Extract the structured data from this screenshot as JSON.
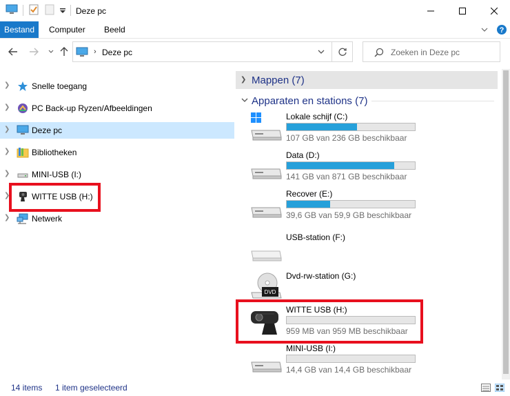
{
  "window": {
    "title": "Deze pc",
    "minimize_label": "",
    "maximize_label": "",
    "close_label": ""
  },
  "ribbon": {
    "tabs": [
      {
        "label": "Bestand",
        "active": true
      },
      {
        "label": "Computer",
        "active": false
      },
      {
        "label": "Beeld",
        "active": false
      }
    ]
  },
  "address": {
    "path": "Deze pc",
    "search_placeholder": "Zoeken in Deze pc"
  },
  "nav_pane": {
    "items": [
      {
        "label": "Snelle toegang",
        "icon": "star-icon",
        "selected": false
      },
      {
        "label": "PC Back-up Ryzen/Afbeeldingen",
        "icon": "cloud-folder-icon",
        "selected": false
      },
      {
        "label": "Deze pc",
        "icon": "computer-icon",
        "selected": true
      },
      {
        "label": "Bibliotheken",
        "icon": "library-icon",
        "selected": false
      },
      {
        "label": "MINI-USB (I:)",
        "icon": "usb-drive-icon",
        "selected": false
      },
      {
        "label": "WITTE USB (H:)",
        "icon": "webcam-icon",
        "selected": false
      },
      {
        "label": "Netwerk",
        "icon": "network-icon",
        "selected": false
      }
    ]
  },
  "content": {
    "groups": [
      {
        "label": "Mappen (7)",
        "expanded": false
      },
      {
        "label": "Apparaten en stations (7)",
        "expanded": true
      }
    ],
    "drives": [
      {
        "name": "Lokale schijf (C:)",
        "free": "107 GB van 236 GB beschikbaar",
        "used_fraction": 0.547,
        "icon": "windows-drive-icon",
        "has_bar": true
      },
      {
        "name": "Data (D:)",
        "free": "141 GB van 871 GB beschikbaar",
        "used_fraction": 0.838,
        "icon": "hard-drive-icon",
        "has_bar": true
      },
      {
        "name": "Recover (E:)",
        "free": "39,6 GB van 59,9 GB beschikbaar",
        "used_fraction": 0.339,
        "icon": "hard-drive-icon",
        "has_bar": true
      },
      {
        "name": "USB-station (F:)",
        "free": "",
        "used_fraction": 0,
        "icon": "usb-drive-icon",
        "has_bar": false
      },
      {
        "name": "Dvd-rw-station (G:)",
        "free": "",
        "used_fraction": 0,
        "icon": "dvd-drive-icon",
        "has_bar": false
      },
      {
        "name": "WITTE USB (H:)",
        "free": "959 MB van 959 MB beschikbaar",
        "used_fraction": 0,
        "icon": "webcam-icon",
        "has_bar": true
      },
      {
        "name": "MINI-USB (I:)",
        "free": "14,4 GB van 14,4 GB beschikbaar",
        "used_fraction": 0,
        "icon": "hard-drive-icon",
        "has_bar": true
      }
    ]
  },
  "status": {
    "items_count": "14 items",
    "selected": "1 item geselecteerd"
  },
  "colors": {
    "accent": "#1979ca",
    "selection": "#cce8ff",
    "bar_fill": "#26a0da",
    "highlight": "#e8101e",
    "group_text": "#1e3287"
  }
}
